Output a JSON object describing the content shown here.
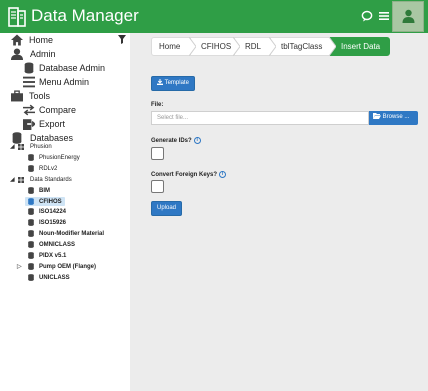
{
  "header": {
    "title": "Data Manager",
    "accent": "#2f9e46"
  },
  "sidebar": {
    "home": "Home",
    "admin": "Admin",
    "database_admin": "Database Admin",
    "menu_admin": "Menu Admin",
    "tools": "Tools",
    "compare": "Compare",
    "export": "Export",
    "databases": "Databases",
    "phusion": "Phusion",
    "phusion_energy": "PhusionEnergy",
    "rdl_v2": "RDLv2",
    "data_standards": "Data Standards",
    "standards": [
      "BIM",
      "CFIHOS",
      "ISO14224",
      "ISO15926",
      "Noun-Modifier Material",
      "OMNICLASS",
      "PIDX v5.1",
      "Pump OEM (Flange)",
      "UNICLASS"
    ],
    "selected_standard": "CFIHOS"
  },
  "breadcrumb": [
    "Home",
    "CFIHOS",
    "RDL",
    "tblTagClass",
    "Insert Data"
  ],
  "form": {
    "template_button": "Template",
    "file_label": "File:",
    "file_placeholder": "Select file...",
    "browse_button": "Browse ...",
    "generate_ids_label": "Generate IDs?",
    "convert_keys_label": "Convert Foreign Keys?",
    "upload_button": "Upload"
  }
}
